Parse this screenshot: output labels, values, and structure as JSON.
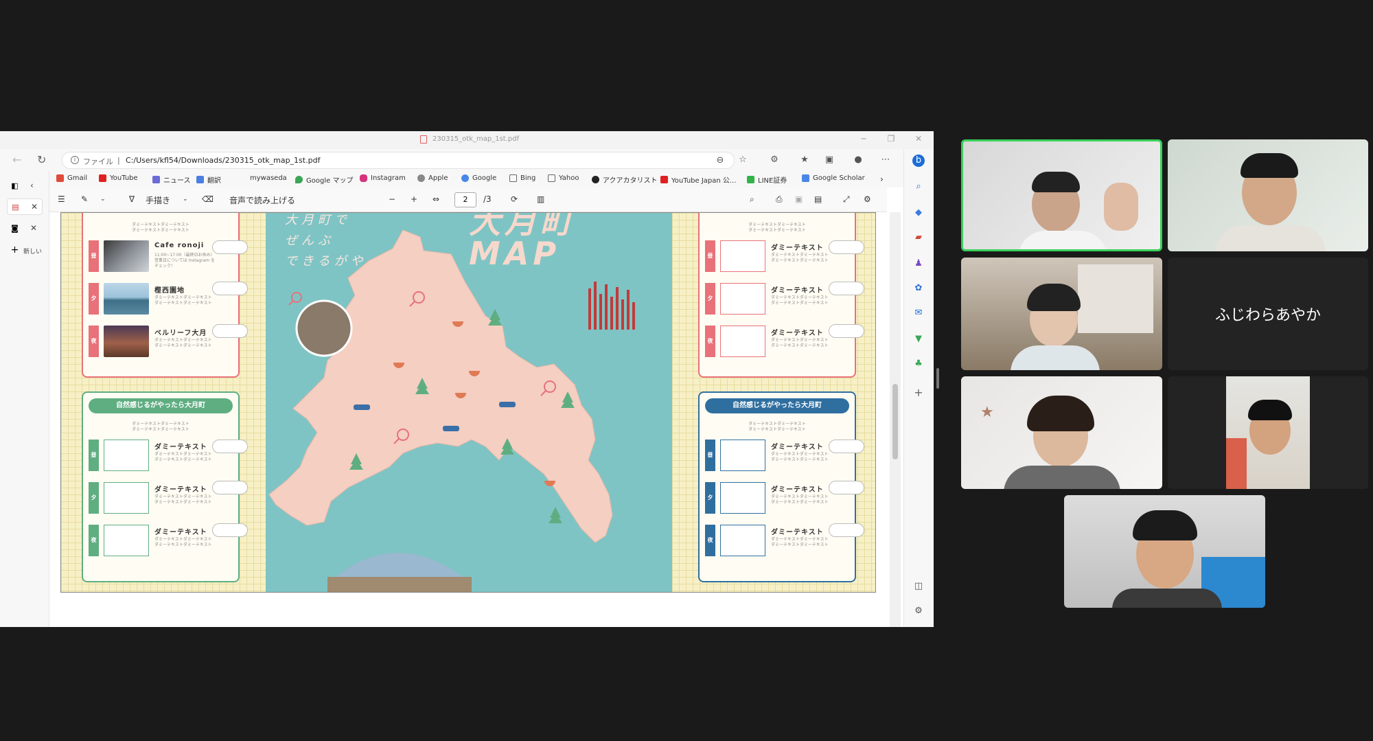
{
  "browser": {
    "tab_title": "230315_otk_map_1st.pdf",
    "address_label": "ファイル",
    "address_path": "C:/Users/kfl54/Downloads/230315_otk_map_1st.pdf",
    "bookmarks": [
      "Gmail",
      "YouTube",
      "ニュース",
      "翻訳",
      "mywaseda",
      "Google マップ",
      "Instagram",
      "Apple",
      "Google",
      "Bing",
      "Yahoo",
      "アクアカタリスト",
      "YouTube Japan 公...",
      "LINE証券",
      "Google Scholar"
    ],
    "new_tab_label": "新しい"
  },
  "pdf_toolbar": {
    "draw_label": "手描き",
    "read_aloud_label": "音声で読み上げる",
    "current_page": "2",
    "page_total": "/3"
  },
  "pdf": {
    "map_title": "大月町 MAP",
    "map_caption_lines": [
      "大月町で",
      "ぜんぶ",
      "できるがや"
    ],
    "left_top_card": {
      "intro_lines": [
        "ダミーテキストダミーテキスト",
        "ダミーテキストダミーテキスト"
      ],
      "rows": [
        {
          "tag": "昼",
          "title": "Cafe ronoji",
          "sub_lines": [
            "11:00~17:00（最終日お休み）",
            "営業日については Instagram を",
            "チェック！"
          ]
        },
        {
          "tag": "夕",
          "title": "樫西園地",
          "sub_lines": [
            "ダミーテキストダミーテキスト",
            "ダミーテキストダミーテキスト"
          ]
        },
        {
          "tag": "夜",
          "title": "ベルリーフ大月",
          "sub_lines": [
            "ダミーテキストダミーテキスト",
            "ダミーテキストダミーテキスト"
          ]
        }
      ]
    },
    "left_bottom_card": {
      "header": "自然感じるがやったら大月町",
      "intro_lines": [
        "ダミーテキストダミーテキスト",
        "ダミーテキストダミーテキスト"
      ],
      "rows": [
        {
          "tag": "昼",
          "title": "ダミーテキスト",
          "sub_lines": [
            "ダミーテキストダミーテキスト",
            "ダミーテキストダミーテキスト"
          ]
        },
        {
          "tag": "夕",
          "title": "ダミーテキスト",
          "sub_lines": [
            "ダミーテキストダミーテキスト",
            "ダミーテキストダミーテキスト"
          ]
        },
        {
          "tag": "夜",
          "title": "ダミーテキスト",
          "sub_lines": [
            "ダミーテキストダミーテキスト",
            "ダミーテキストダミーテキスト"
          ]
        }
      ]
    },
    "right_top_card": {
      "intro_lines": [
        "ダミーテキストダミーテキスト",
        "ダミーテキストダミーテキスト"
      ],
      "rows": [
        {
          "tag": "昼",
          "title": "ダミーテキスト",
          "sub_lines": [
            "ダミーテキストダミーテキスト",
            "ダミーテキストダミーテキスト"
          ]
        },
        {
          "tag": "夕",
          "title": "ダミーテキスト",
          "sub_lines": [
            "ダミーテキストダミーテキスト",
            "ダミーテキストダミーテキスト"
          ]
        },
        {
          "tag": "夜",
          "title": "ダミーテキスト",
          "sub_lines": [
            "ダミーテキストダミーテキスト",
            "ダミーテキストダミーテキスト"
          ]
        }
      ]
    },
    "right_bottom_card": {
      "header": "自然感じるがやったら大月町",
      "intro_lines": [
        "ダミーテキストダミーテキスト",
        "ダミーテキストダミーテキスト"
      ],
      "rows": [
        {
          "tag": "昼",
          "title": "ダミーテキスト",
          "sub_lines": [
            "ダミーテキストダミーテキスト",
            "ダミーテキストダミーテキスト"
          ]
        },
        {
          "tag": "夕",
          "title": "ダミーテキスト",
          "sub_lines": [
            "ダミーテキストダミーテキスト",
            "ダミーテキストダミーテキスト"
          ]
        },
        {
          "tag": "夜",
          "title": "ダミーテキスト",
          "sub_lines": [
            "ダミーテキストダミーテキスト",
            "ダミーテキストダミーテキスト"
          ]
        }
      ]
    }
  },
  "meeting": {
    "camera_off_name": "ふじわらあやか"
  },
  "colors": {
    "pink": "#e8717a",
    "green": "#5fae82",
    "blue": "#2f6fa0",
    "map_sea": "#7fc4c4",
    "map_land": "#f4cfc2",
    "active_speaker": "#3ad05a"
  },
  "icons": {
    "map_pin": "heart-pin-icon",
    "tree": "tree-icon",
    "bowl": "ramen-bowl-icon",
    "shoe": "sneaker-icon"
  }
}
